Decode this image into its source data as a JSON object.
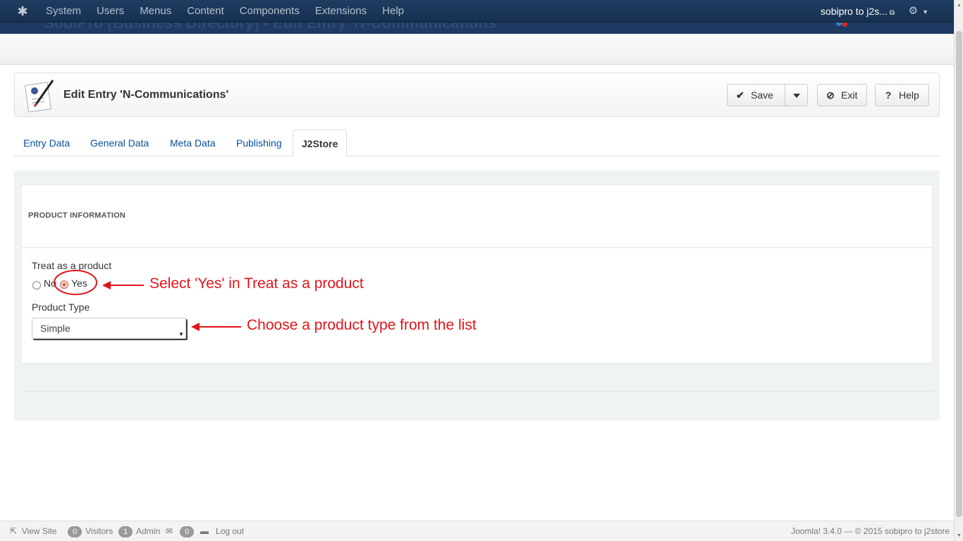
{
  "topbar": {
    "menu": [
      "System",
      "Users",
      "Menus",
      "Content",
      "Components",
      "Extensions",
      "Help"
    ],
    "site_name": "sobipro to j2s..."
  },
  "header": {
    "ghost_title": "SobiPro [Business Directory] - Edit Entry 'N-Communications'"
  },
  "toolbar": {
    "title": "Edit Entry 'N-Communications'",
    "save_label": "Save",
    "exit_label": "Exit",
    "help_label": "Help"
  },
  "tabs": [
    "Entry Data",
    "General Data",
    "Meta Data",
    "Publishing",
    "J2Store"
  ],
  "active_tab": "J2Store",
  "form": {
    "section_title": "PRODUCT INFORMATION",
    "treat_label": "Treat as a product",
    "option_no": "No",
    "option_yes": "Yes",
    "treat_selected": "Yes",
    "type_label": "Product Type",
    "type_value": "Simple"
  },
  "annotations": {
    "yes_hint": "Select 'Yes' in Treat as a product",
    "type_hint": "Choose a product type from the list"
  },
  "footer": {
    "view_site": "View Site",
    "visitors_count": "0",
    "visitors_label": "Visitors",
    "admin_count": "1",
    "admin_label": "Admin",
    "messages_count": "0",
    "logout": "Log out",
    "copyright": "Joomla! 3.4.0  —  © 2015 sobipro to j2store"
  },
  "colors": {
    "topbar": "#1b3a5e",
    "annotation": "#e0161a",
    "link": "#08519c"
  }
}
